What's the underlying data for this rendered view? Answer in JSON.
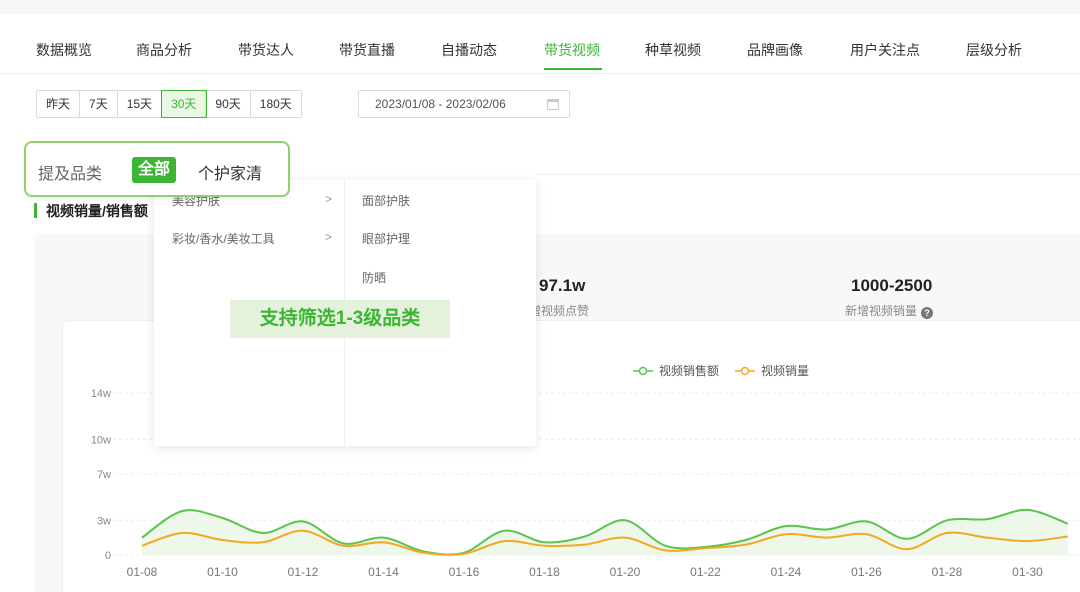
{
  "nav": {
    "items": [
      "数据概览",
      "商品分析",
      "带货达人",
      "带货直播",
      "自播动态",
      "带货视频",
      "种草视频",
      "品牌画像",
      "用户关注点",
      "层级分析"
    ],
    "active": "带货视频"
  },
  "range": {
    "options": [
      "昨天",
      "7天",
      "15天",
      "30天",
      "90天",
      "180天"
    ],
    "selected": "30天"
  },
  "date_range": "2023/01/08  - 2023/02/06",
  "filter": {
    "label": "提及品类",
    "all": "全部",
    "option": "个护家清"
  },
  "dropdown": {
    "level1": [
      "美容护肤",
      "彩妆/香水/美妆工具"
    ],
    "level2": [
      "面部护肤",
      "眼部护理",
      "防晒"
    ],
    "promo": "支持筛选1-3级品类"
  },
  "section": {
    "title": "视频销量/销售额"
  },
  "stats": [
    {
      "value": "97.1w",
      "label": "新增视频点赞"
    },
    {
      "value": "1000-2500",
      "label": "新增视频销量"
    }
  ],
  "chart_data": {
    "type": "line",
    "x": [
      "01-08",
      "01-09",
      "01-10",
      "01-11",
      "01-12",
      "01-13",
      "01-14",
      "01-15",
      "01-16",
      "01-17",
      "01-18",
      "01-19",
      "01-20",
      "01-21",
      "01-22",
      "01-23",
      "01-24",
      "01-25",
      "01-26",
      "01-27",
      "01-28",
      "01-29",
      "01-30",
      "01-31"
    ],
    "x_ticks": [
      "01-08",
      "01-10",
      "01-12",
      "01-14",
      "01-16",
      "01-18",
      "01-20",
      "01-22",
      "01-24",
      "01-26",
      "01-28",
      "01-30"
    ],
    "y_ticks": [
      "0",
      "3w",
      "7w",
      "10w",
      "14w"
    ],
    "ylim": [
      0,
      140000
    ],
    "series": [
      {
        "name": "视频销售额",
        "color": "#5cc34e",
        "values": [
          15000,
          38000,
          32000,
          19000,
          29000,
          10000,
          15000,
          3000,
          2000,
          21000,
          11000,
          16000,
          30000,
          8000,
          7000,
          13000,
          25000,
          22000,
          29000,
          14000,
          30000,
          31000,
          39000,
          27000
        ]
      },
      {
        "name": "视频销量",
        "color": "#f5a623",
        "values": [
          8000,
          19000,
          13000,
          11000,
          21000,
          8000,
          11000,
          2000,
          1000,
          12000,
          8000,
          9000,
          15000,
          4000,
          6000,
          9000,
          18000,
          15000,
          18000,
          5000,
          19000,
          15000,
          12000,
          16000
        ]
      }
    ],
    "legend": "top-center",
    "grid": true
  }
}
